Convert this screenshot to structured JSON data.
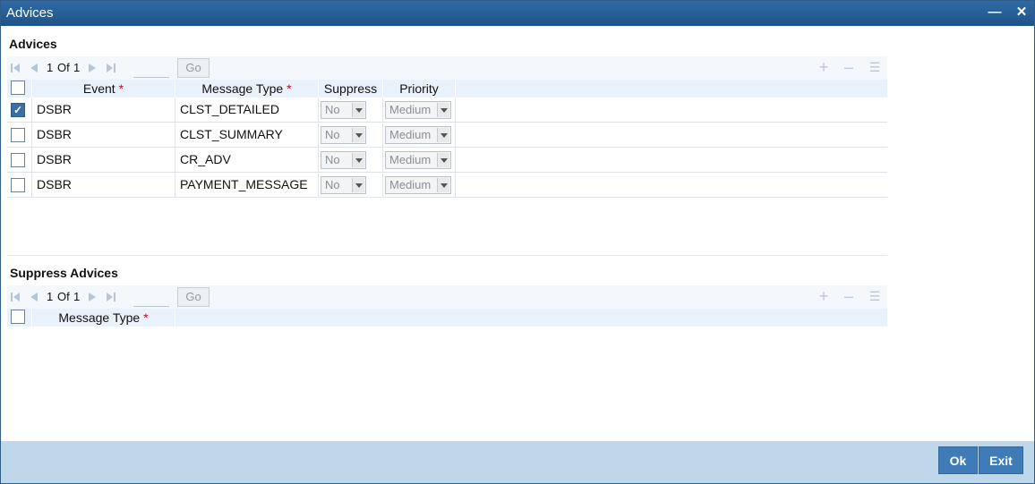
{
  "window": {
    "title": "Advices"
  },
  "advices": {
    "section_title": "Advices",
    "pager": {
      "current": "1",
      "of_label": "Of",
      "total": "1",
      "go_label": "Go"
    },
    "columns": {
      "event": "Event",
      "message_type": "Message Type",
      "suppress": "Suppress",
      "priority": "Priority",
      "required_mark": "*"
    },
    "rows": [
      {
        "checked": true,
        "event": "DSBR",
        "message_type": "CLST_DETAILED",
        "suppress": "No",
        "priority": "Medium"
      },
      {
        "checked": false,
        "event": "DSBR",
        "message_type": "CLST_SUMMARY",
        "suppress": "No",
        "priority": "Medium"
      },
      {
        "checked": false,
        "event": "DSBR",
        "message_type": "CR_ADV",
        "suppress": "No",
        "priority": "Medium"
      },
      {
        "checked": false,
        "event": "DSBR",
        "message_type": "PAYMENT_MESSAGE",
        "suppress": "No",
        "priority": "Medium"
      }
    ]
  },
  "suppress_advices": {
    "section_title": "Suppress Advices",
    "pager": {
      "current": "1",
      "of_label": "Of",
      "total": "1",
      "go_label": "Go"
    },
    "columns": {
      "message_type": "Message Type",
      "required_mark": "*"
    }
  },
  "footer": {
    "ok_label": "Ok",
    "exit_label": "Exit"
  },
  "icons": {
    "first": "first-page-icon",
    "prev": "prev-page-icon",
    "next": "next-page-icon",
    "last": "last-page-icon",
    "add": "add-row-icon",
    "delete": "delete-row-icon",
    "view": "single-view-icon",
    "minimize": "minimize-icon",
    "close": "close-icon"
  }
}
